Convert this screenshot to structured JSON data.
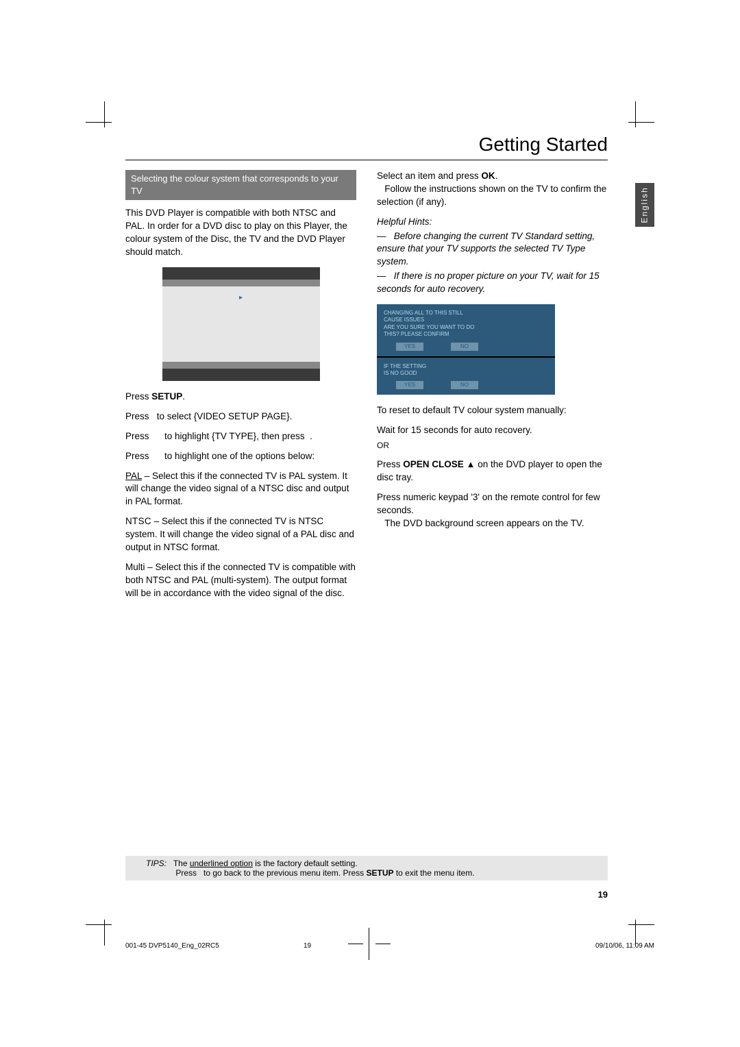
{
  "header": {
    "title": "Getting Started"
  },
  "tab": {
    "label": "English"
  },
  "left": {
    "section_title": "Selecting the colour system that corresponds to your TV",
    "intro": "This DVD Player is compatible with both NTSC and PAL. In order for a DVD disc to play on this Player, the colour system of the Disc, the TV and the DVD Player should match.",
    "step1_a": "Press ",
    "step1_b": "SETUP",
    "step1_c": ".",
    "step2": "Press   to select {VIDEO SETUP PAGE}.",
    "step3": "Press      to highlight {TV TYPE}, then press  .",
    "step4": "Press      to highlight one of the options below:",
    "pal_label": "PAL",
    "pal_text": " – Select this if the connected TV is PAL system. It will change the video signal of a NTSC disc and output in PAL format.",
    "ntsc_label": "NTSC",
    "ntsc_text": " – Select this if the connected TV is NTSC system. It will change the video signal of a PAL disc and output in NTSC format.",
    "multi_label": "Multi",
    "multi_text": " – Select this if the connected TV is compatible with both NTSC and PAL (multi-system).  The output format will be in accordance with the video signal of the disc."
  },
  "right": {
    "select_a": "Select an item and press ",
    "select_b": "OK",
    "select_c": ".",
    "follow": "Follow the instructions shown on the TV to confirm the selection (if any).",
    "hints_label": "Helpful Hints:",
    "hint1": "—   Before changing the current TV Standard setting, ensure that your TV supports the selected TV Type system.",
    "hint2": "—   If there is no proper picture on your TV, wait for 15 seconds for auto recovery.",
    "reset_title": "To reset to default TV colour system manually:",
    "reset1": "Wait for 15 seconds for auto recovery.",
    "or": "OR",
    "reset2_a": "Press ",
    "reset2_b": "OPEN CLOSE",
    "reset2_c": " on the DVD player to open the disc tray.",
    "reset3_a": "Press ",
    "reset3_b": "numeric keypad '3'",
    "reset3_c": " on the remote control for few seconds.",
    "reset3_result": "The DVD background screen appears on the TV.",
    "osd_panel1_lines": "CHANGING ALL TO THIS STILL\nCAUSE ISSUES\nARE YOU SURE YOU WANT TO DO\nTHIS? PLEASE CONFIRM",
    "osd_panel2_lines": "IF THE SETTING\nIS NO GOOD",
    "osd_btn_yes": "YES",
    "osd_btn_no": "NO"
  },
  "tips": {
    "label": "TIPS:",
    "line1_a": "The ",
    "line1_b": "underlined option",
    "line1_c": " is the factory default setting.",
    "line2_a": "Press   to go back to the previous menu item. Press ",
    "line2_b": "SETUP",
    "line2_c": " to exit the menu item."
  },
  "page_number": "19",
  "footer": {
    "file": "001-45 DVP5140_Eng_02RC5",
    "page": "19",
    "datetime": "09/10/06, 11:09 AM"
  }
}
